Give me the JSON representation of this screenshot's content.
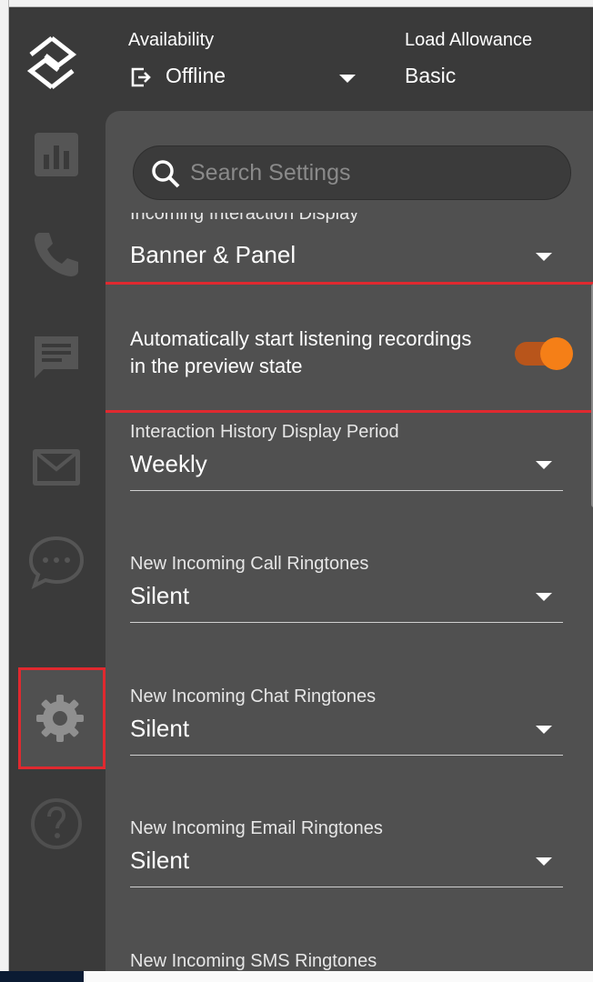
{
  "header": {
    "availability_label": "Availability",
    "availability_value": "Offline",
    "load_label": "Load Allowance",
    "load_value": "Basic"
  },
  "nav": [
    {
      "name": "reports",
      "icon": "bar-chart-icon"
    },
    {
      "name": "phone",
      "icon": "phone-icon"
    },
    {
      "name": "messages",
      "icon": "message-icon"
    },
    {
      "name": "email",
      "icon": "mail-icon"
    },
    {
      "name": "chat",
      "icon": "chat-bubble-icon"
    },
    {
      "name": "settings",
      "icon": "gear-icon",
      "selected": true
    },
    {
      "name": "help",
      "icon": "help-icon"
    }
  ],
  "settings": {
    "search_placeholder": "Search Settings",
    "incoming_display": {
      "label": "Incoming Interaction Display",
      "value": "Banner & Panel"
    },
    "auto_listen": {
      "label": "Automatically start listening recordings in the preview state",
      "enabled": true
    },
    "history_period": {
      "label": "Interaction History Display Period",
      "value": "Weekly"
    },
    "call_ringtone": {
      "label": "New Incoming Call Ringtones",
      "value": "Silent"
    },
    "chat_ringtone": {
      "label": "New Incoming Chat Ringtones",
      "value": "Silent"
    },
    "email_ringtone": {
      "label": "New Incoming Email Ringtones",
      "value": "Silent"
    },
    "sms_ringtone": {
      "label": "New Incoming SMS Ringtones"
    }
  },
  "colors": {
    "app_bg": "#3a3a3a",
    "panel_bg": "#505050",
    "highlight": "#e0292f",
    "toggle_on": "#f57f17"
  }
}
